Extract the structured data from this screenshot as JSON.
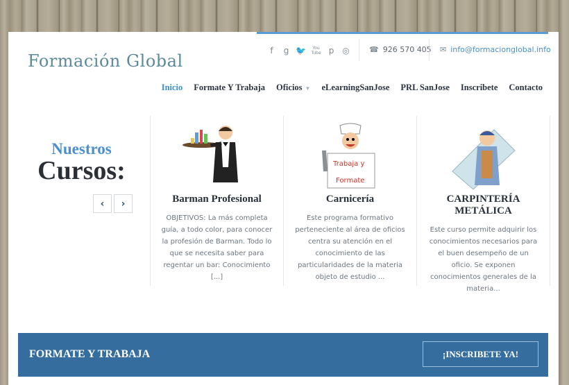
{
  "brand": {
    "logo_text": "Formación Global"
  },
  "topbar": {
    "social_icons": [
      "facebook-icon",
      "google-plus-icon",
      "twitter-icon",
      "youtube-icon",
      "pinterest-icon",
      "dribbble-icon"
    ],
    "social_glyphs": [
      "f",
      "g",
      "🐦",
      "You Tube",
      "p",
      "◎"
    ],
    "phone_icon": "☎",
    "phone": "926 570 405",
    "email_icon": "✉",
    "email": "info@formacionglobal.info"
  },
  "nav": {
    "items": [
      {
        "label": "Inicio"
      },
      {
        "label": "Formate Y Trabaja"
      },
      {
        "label": "Oficios"
      },
      {
        "label": "eLearningSanJose"
      },
      {
        "label": "PRL SanJose"
      },
      {
        "label": "Inscribete"
      },
      {
        "label": "Contacto"
      }
    ],
    "caret": "▼"
  },
  "courses": {
    "heading_small": "Nuestros",
    "heading_big": "Cursos:",
    "prev": "‹",
    "next": "›",
    "items": [
      {
        "title": "Barman Profesional",
        "desc": "OBJETIVOS: La más completa guía, a todo color, para conocer la profesión de Barman. Todo lo que se necesita saber para regentar un bar: Conocimiento [...]"
      },
      {
        "title": "Carnicería",
        "desc": "Este programa formativo perteneciente al área de oficios centra su atención en el conocimiento de las particularidades de la materia objeto de estudio ...",
        "sign_line1": "Trabaja y",
        "sign_line2": "Formate"
      },
      {
        "title": "CARPINTERÍA METÁLICA",
        "desc": "Este curso permite adquirir los conocimientos necesarios para el buen desempeño de un oficio. Se exponen conocimientos generales de la materia..."
      }
    ]
  },
  "banner": {
    "title": "FORMATE Y TRABAJA",
    "button": "¡INSCRIBETE YA!"
  }
}
